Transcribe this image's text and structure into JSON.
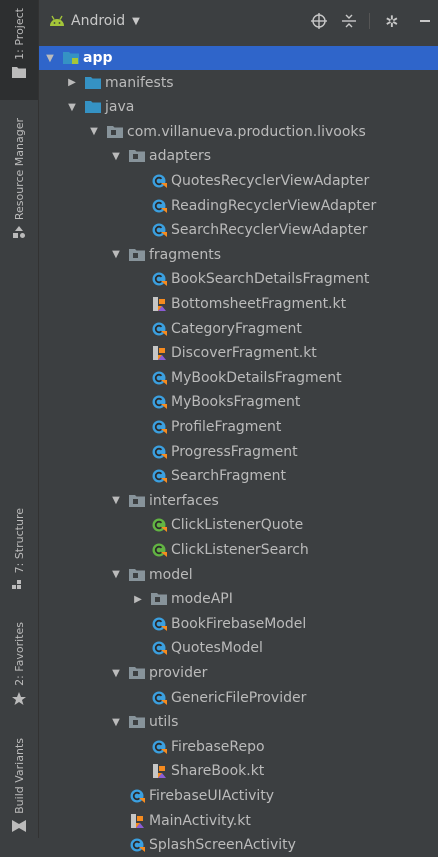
{
  "left_strip": {
    "project_tab": "1: Project",
    "resource_manager_tab": "Resource Manager",
    "structure_tab": "7: Structure",
    "favorites_tab": "2: Favorites",
    "build_variants_tab": "Build Variants"
  },
  "header": {
    "view": "Android",
    "icons": [
      "add-target-icon",
      "collapse-all-icon",
      "settings-icon",
      "minimize-icon"
    ]
  },
  "tree": [
    {
      "label": "app",
      "kind": "module",
      "expanded": true
    },
    {
      "label": "manifests",
      "kind": "folder",
      "expanded": false
    },
    {
      "label": "java",
      "kind": "folder",
      "expanded": true
    },
    {
      "label": "com.villanueva.production.livooks",
      "kind": "package",
      "expanded": true
    },
    {
      "label": "adapters",
      "kind": "package",
      "expanded": true
    },
    {
      "label": "QuotesRecyclerViewAdapter",
      "kind": "class"
    },
    {
      "label": "ReadingRecyclerViewAdapter",
      "kind": "class"
    },
    {
      "label": "SearchRecyclerViewAdapter",
      "kind": "class"
    },
    {
      "label": "fragments",
      "kind": "package",
      "expanded": true
    },
    {
      "label": "BookSearchDetailsFragment",
      "kind": "class"
    },
    {
      "label": "BottomsheetFragment.kt",
      "kind": "kotlin-file"
    },
    {
      "label": "CategoryFragment",
      "kind": "class"
    },
    {
      "label": "DiscoverFragment.kt",
      "kind": "kotlin-file"
    },
    {
      "label": "MyBookDetailsFragment",
      "kind": "class"
    },
    {
      "label": "MyBooksFragment",
      "kind": "class"
    },
    {
      "label": "ProfileFragment",
      "kind": "class"
    },
    {
      "label": "ProgressFragment",
      "kind": "class"
    },
    {
      "label": "SearchFragment",
      "kind": "class"
    },
    {
      "label": "interfaces",
      "kind": "package",
      "expanded": true
    },
    {
      "label": "ClickListenerQuote",
      "kind": "interface"
    },
    {
      "label": "ClickListenerSearch",
      "kind": "interface"
    },
    {
      "label": "model",
      "kind": "package",
      "expanded": true
    },
    {
      "label": "modeAPI",
      "kind": "package",
      "expanded": false
    },
    {
      "label": "BookFirebaseModel",
      "kind": "class"
    },
    {
      "label": "QuotesModel",
      "kind": "class"
    },
    {
      "label": "provider",
      "kind": "package",
      "expanded": true
    },
    {
      "label": "GenericFileProvider",
      "kind": "class"
    },
    {
      "label": "utils",
      "kind": "package",
      "expanded": true
    },
    {
      "label": "FirebaseRepo",
      "kind": "class"
    },
    {
      "label": "ShareBook.kt",
      "kind": "kotlin-file"
    },
    {
      "label": "FirebaseUIActivity",
      "kind": "class"
    },
    {
      "label": "MainActivity.kt",
      "kind": "kotlin-file"
    },
    {
      "label": "SplashScreenActivity",
      "kind": "class"
    }
  ],
  "colors": {
    "background": "#3c3f41",
    "selection": "#2f65ca",
    "folder": "#87939a",
    "module_folder": "#3592c4",
    "android_green": "#a4c639",
    "class_blue": "#3ba0e0",
    "interface_green": "#62b543",
    "kotlin_orange": "#f68b1f"
  }
}
